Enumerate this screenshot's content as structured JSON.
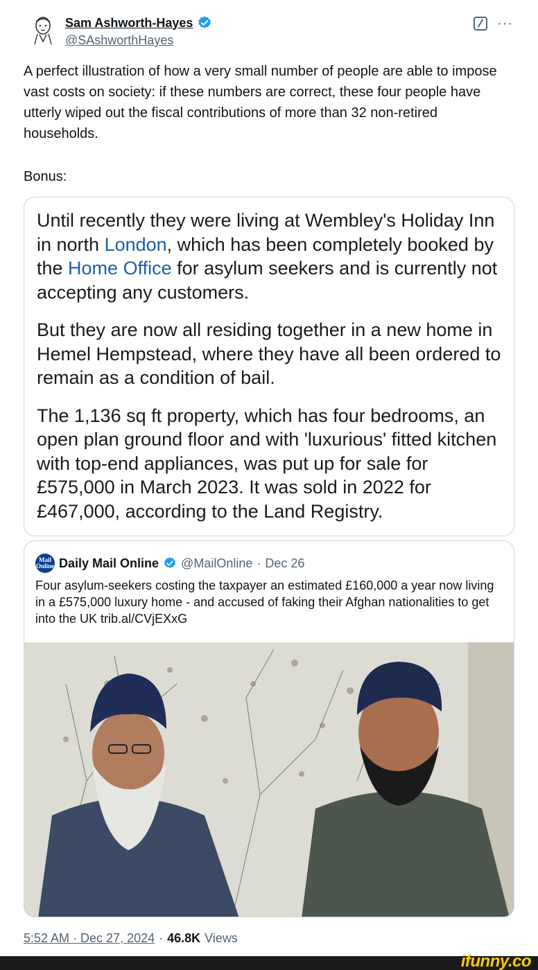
{
  "author": {
    "name": "Sam Ashworth-Hayes",
    "handle": "@SAshworthHayes"
  },
  "tweet": {
    "text": "A perfect illustration of how a very small number of people are able to impose vast costs on society: if these numbers are correct, these four people have utterly wiped out the fiscal contributions of more than 32 non-retired households.",
    "bonus": "Bonus:"
  },
  "screenshot_quote": {
    "p1_a": "Until recently they were living at Wembley's Holiday Inn in north ",
    "p1_link1": "London",
    "p1_b": ", which has been completely booked by the ",
    "p1_link2": "Home Office",
    "p1_c": " for asylum seekers and is currently not accepting any customers.",
    "p2": "But they are now all residing together in a new home in Hemel Hempstead, where they have all been ordered to remain as a condition of bail.",
    "p3": "The 1,136 sq ft property, which has four bedrooms, an open plan ground floor and with 'luxurious' fitted kitchen with top-end appliances, was put up for sale for £575,000 in March 2023. It was sold in 2022 for £467,000, according to the Land Registry."
  },
  "embedded_tweet": {
    "logo_text": "Mail Online",
    "name": "Daily Mail Online",
    "handle": "@MailOnline",
    "date": "Dec 26",
    "text": "Four asylum-seekers costing the taxpayer an estimated £160,000 a year now living in a £575,000 luxury home - and accused of faking their Afghan nationalities to get into the UK trib.al/CVjEXxG"
  },
  "footer": {
    "timestamp": "5:52 AM · Dec 27, 2024",
    "separator": "·",
    "views_count": "46.8K",
    "views_label": "Views"
  },
  "watermark": "ifunny.co",
  "colors": {
    "verified": "#1d9bf0",
    "link": "#1d5fa8",
    "muted": "#536471",
    "border": "#cfd9de"
  }
}
